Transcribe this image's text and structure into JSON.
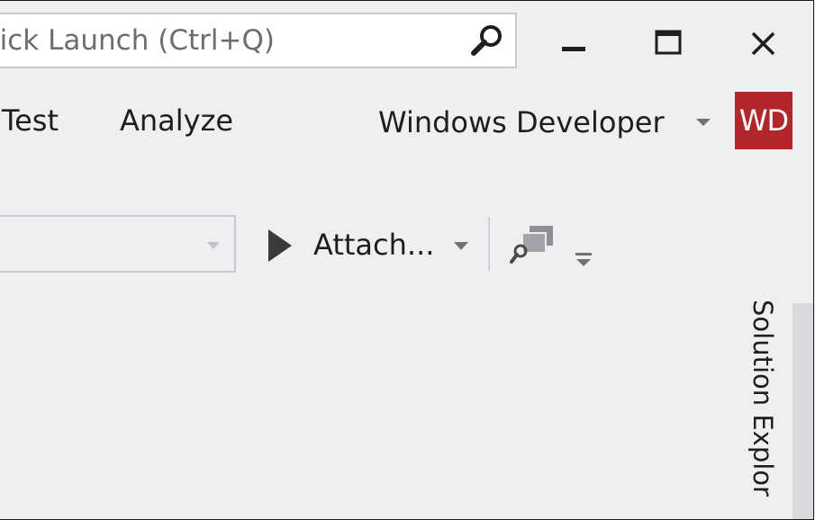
{
  "title_bar": {
    "quick_launch_placeholder": "uick Launch (Ctrl+Q)"
  },
  "menu": {
    "items": [
      {
        "label": "Test"
      },
      {
        "label": "Analyze"
      }
    ]
  },
  "account": {
    "name": "Windows Developer",
    "initials": "WD",
    "avatar_color": "#b3262a"
  },
  "toolbar": {
    "attach_label": "Attach..."
  },
  "side_panel": {
    "solution_explorer_label": "Solution Explor"
  },
  "icons": [
    "search-icon",
    "minimize-icon",
    "maximize-icon",
    "close-icon",
    "play-icon",
    "chevron-down-icon",
    "find-window-icon",
    "overflow-icon"
  ]
}
